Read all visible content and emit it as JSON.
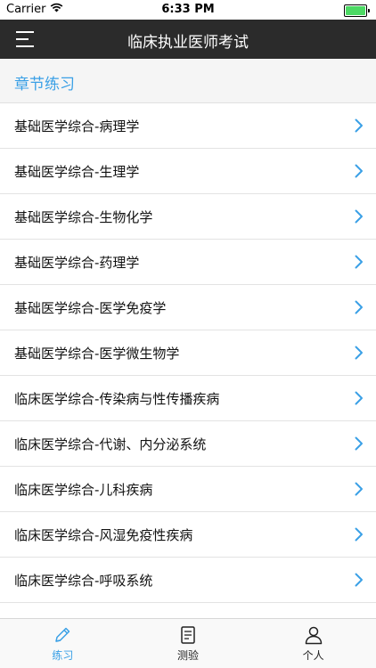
{
  "status_bar": {
    "carrier": "Carrier",
    "time": "6:33 PM",
    "battery_level": 1.0,
    "battery_color": "#4cd964"
  },
  "nav": {
    "title": "临床执业医师考试",
    "menu_icon": "hamburger-menu-icon",
    "background": "#2b2b2b"
  },
  "section": {
    "title": "章节练习",
    "color": "#3aa0e6"
  },
  "chapters": [
    "基础医学综合-病理学",
    "基础医学综合-生理学",
    "基础医学综合-生物化学",
    "基础医学综合-药理学",
    "基础医学综合-医学免疫学",
    "基础医学综合-医学微生物学",
    "临床医学综合-传染病与性传播疾病",
    "临床医学综合-代谢、内分泌系统",
    "临床医学综合-儿科疾病",
    "临床医学综合-风湿免疫性疾病",
    "临床医学综合-呼吸系统"
  ],
  "tabs": [
    {
      "label": "练习",
      "icon": "pencil-icon",
      "active": true
    },
    {
      "label": "测验",
      "icon": "document-icon",
      "active": false
    },
    {
      "label": "个人",
      "icon": "person-icon",
      "active": false
    }
  ],
  "colors": {
    "accent": "#3aa0e6",
    "chevron": "#3aa0e6",
    "tab_inactive": "#222222"
  }
}
